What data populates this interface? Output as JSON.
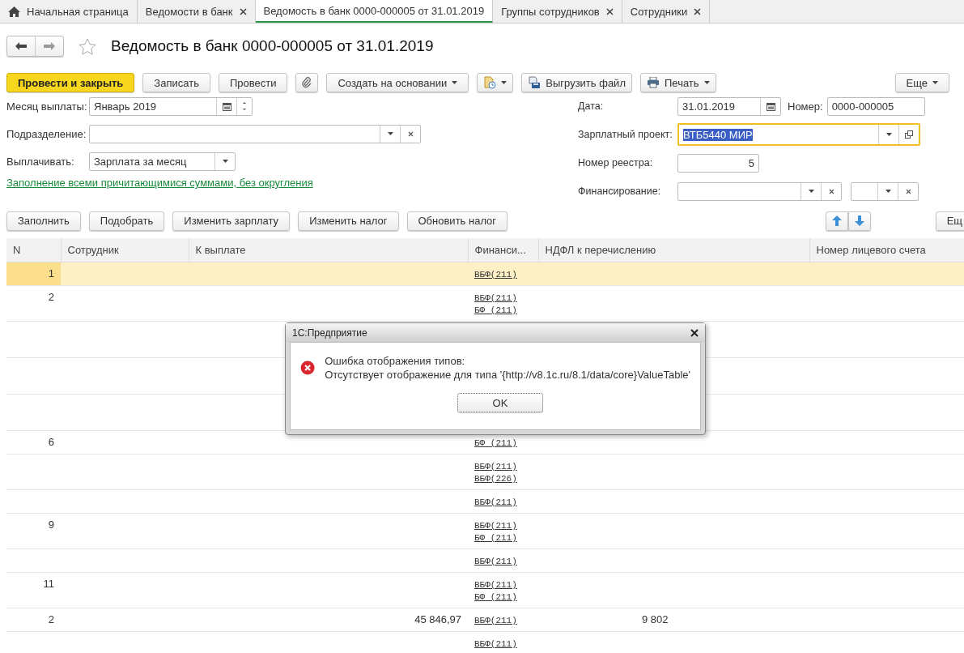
{
  "tabs": [
    {
      "label": "Начальная страница",
      "kind": "home",
      "selected": false
    },
    {
      "label": "Ведомости в банк",
      "kind": "closable",
      "selected": false
    },
    {
      "label": "Ведомость в банк 0000-000005 от 31.01.2019",
      "kind": "plain",
      "selected": true
    },
    {
      "label": "Группы сотрудников",
      "kind": "closable",
      "selected": false
    },
    {
      "label": "Сотрудники",
      "kind": "closable",
      "selected": false
    }
  ],
  "title": "Ведомость в банк 0000-000005 от 31.01.2019",
  "favorite": false,
  "command_bar": [
    {
      "label": "Провести и закрыть",
      "kind": "primary"
    },
    {
      "label": "Записать",
      "kind": "plain"
    },
    {
      "label": "Провести",
      "kind": "plain"
    },
    {
      "kind": "attach"
    },
    {
      "label": "Создать на основании",
      "kind": "menu"
    },
    {
      "kind": "doc-menu"
    },
    {
      "label": "Выгрузить файл",
      "kind": "export"
    },
    {
      "label": "Печать",
      "kind": "print"
    },
    {
      "label": "Еще",
      "kind": "more"
    }
  ],
  "form_left": [
    {
      "label": "Месяц выплаты:",
      "value": "Январь 2019",
      "kind": "month"
    },
    {
      "label": "Подразделение:",
      "kind": "select-clear"
    },
    {
      "label": "Выплачивать:",
      "value": "Зарплата за месяц",
      "kind": "select"
    }
  ],
  "fill_link": "Заполнение всеми причитающимися суммами, без округления",
  "form_right": {
    "date_label": "Дата:",
    "date": "31.01.2019",
    "number_label": "Номер:",
    "number": "0000-000005",
    "project_label": "Зарплатный проект:",
    "project": "ВТБ5440  МИР",
    "project_focused": true,
    "registry_label": "Номер реестра:",
    "registry": "5",
    "funding_label": "Финансирование:"
  },
  "table_toolbar": [
    {
      "label": "Заполнить"
    },
    {
      "label": "Подобрать"
    },
    {
      "label": "Изменить зарплату"
    },
    {
      "label": "Изменить налог"
    },
    {
      "label": "Обновить налог"
    }
  ],
  "table_more": "Ещ",
  "table": {
    "columns": [
      "N",
      "Сотрудник",
      "К выплате",
      "Финанси...",
      "НДФЛ к перечислению",
      "Номер лицевого счета"
    ],
    "rows": [
      {
        "n": "1",
        "funding": [
          "ВБФ(211)"
        ],
        "selected": true
      },
      {
        "n": "2",
        "funding": [
          "ВБФ(211)",
          "БФ (211)"
        ],
        "selected": false
      },
      {
        "selected": false
      },
      {
        "selected": false
      },
      {
        "selected": false
      },
      {
        "n": "6",
        "funding": [
          "БФ (211)"
        ],
        "selected": false
      },
      {
        "funding": [
          "ВБФ(211)",
          "ВБФ(226)"
        ],
        "selected": false
      },
      {
        "funding": [
          "ВБФ(211)"
        ],
        "selected": false
      },
      {
        "n": "9",
        "funding": [
          "ВБФ(211)",
          "БФ (211)"
        ],
        "selected": false
      },
      {
        "funding": [
          "ВБФ(211)"
        ],
        "selected": false
      },
      {
        "n": "11",
        "funding": [
          "ВБФ(211)",
          "БФ (211)"
        ],
        "selected": false
      },
      {
        "n": "2",
        "amount": "45 846,97",
        "ndfl": "9 802",
        "funding": [
          "ВБФ(211)"
        ],
        "selected": false
      },
      {
        "funding": [
          "ВБФ(211)"
        ],
        "selected": false
      }
    ]
  },
  "dialog": {
    "title": "1С:Предприятие",
    "kind": "error",
    "lines": [
      "Ошибка отображения типов:",
      "Отсутствует отображение для типа '{http://v8.1c.ru/8.1/data/core}ValueTable'"
    ],
    "button": "OK"
  }
}
